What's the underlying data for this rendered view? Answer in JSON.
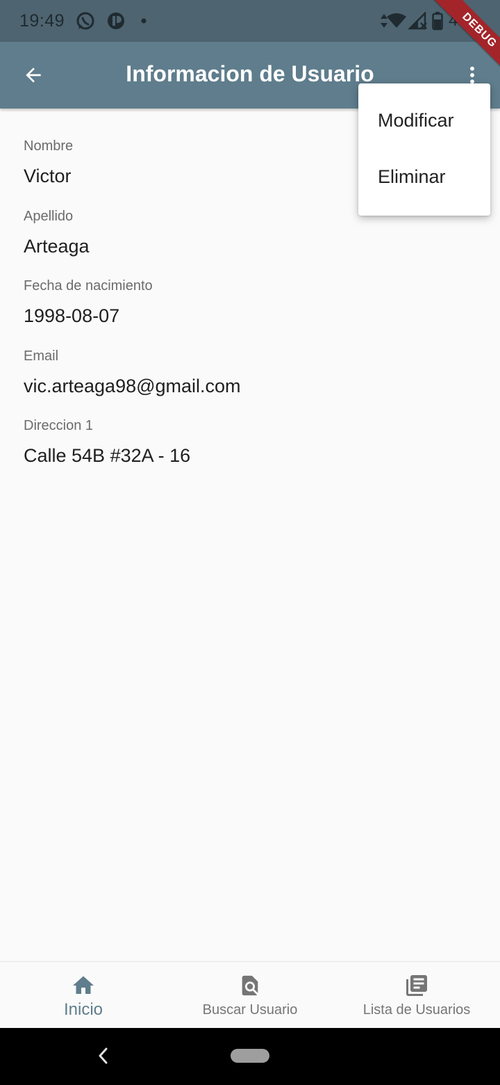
{
  "status_bar": {
    "time": "19:49",
    "battery_text": "4",
    "icons": [
      "whatsapp-icon",
      "app-notification-icon",
      "dot-icon",
      "data-arrows-icon",
      "wifi-icon",
      "signal-icon",
      "battery-icon"
    ]
  },
  "debug_banner": "DEBUG",
  "app_bar": {
    "title": "Informacion de Usuario",
    "back_icon": "arrow-back-icon",
    "more_icon": "more-vert-icon",
    "color": "#5f7d8c"
  },
  "fields": {
    "nombre": {
      "label": "Nombre",
      "value": "Victor"
    },
    "apellido": {
      "label": "Apellido",
      "value": "Arteaga"
    },
    "fecha": {
      "label": "Fecha de nacimiento",
      "value": "1998-08-07"
    },
    "email": {
      "label": "Email",
      "value": "vic.arteaga98@gmail.com"
    },
    "direccion": {
      "label": "Direccion 1",
      "value": "Calle 54B #32A - 16"
    }
  },
  "popup_menu": {
    "items": [
      {
        "label": "Modificar"
      },
      {
        "label": "Eliminar"
      }
    ]
  },
  "bottom_nav": {
    "items": [
      {
        "label": "Inicio",
        "icon": "home-icon",
        "active": true
      },
      {
        "label": "Buscar Usuario",
        "icon": "find-in-page-icon",
        "active": false
      },
      {
        "label": "Lista de Usuarios",
        "icon": "library-books-icon",
        "active": false
      }
    ],
    "active_color": "#5f7d8c",
    "inactive_color": "#757575"
  }
}
